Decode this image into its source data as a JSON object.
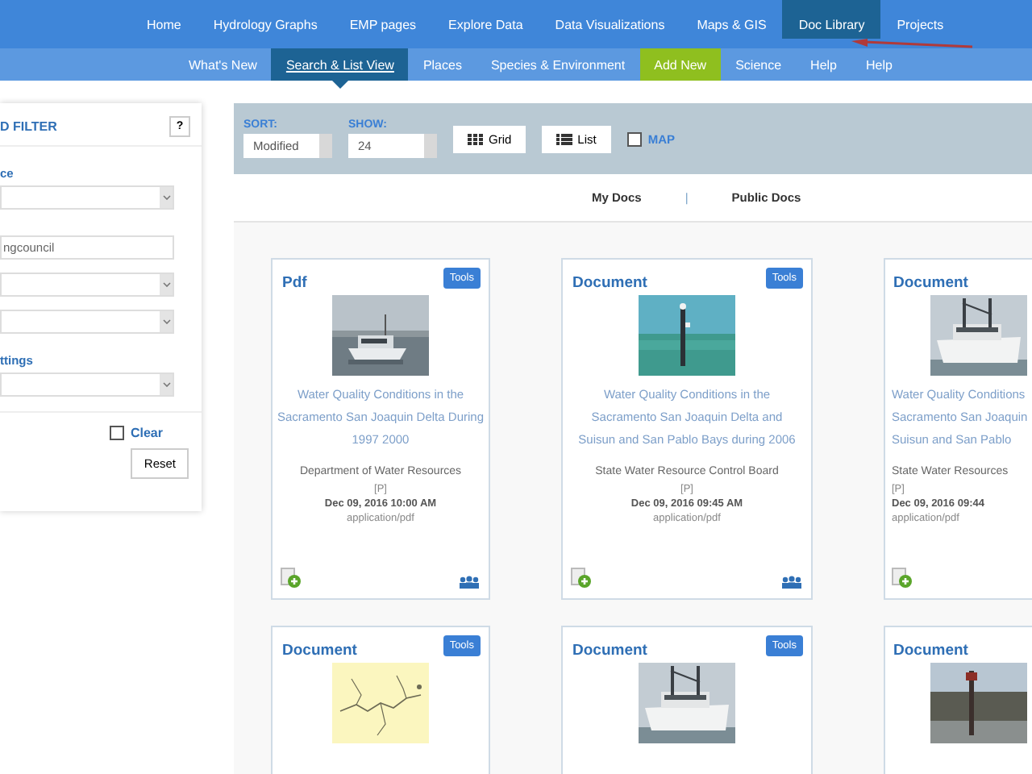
{
  "main_nav": [
    {
      "label": "Home",
      "selected": false
    },
    {
      "label": "Hydrology Graphs",
      "selected": false
    },
    {
      "label": "EMP pages",
      "selected": false
    },
    {
      "label": "Explore Data",
      "selected": false
    },
    {
      "label": "Data Visualizations",
      "selected": false
    },
    {
      "label": "Maps & GIS",
      "selected": false
    },
    {
      "label": "Doc Library",
      "selected": true
    },
    {
      "label": "Projects",
      "selected": false
    }
  ],
  "sub_nav": [
    {
      "label": "What's New",
      "selected": false,
      "kind": "link"
    },
    {
      "label": "Search & List View",
      "selected": true,
      "kind": "link"
    },
    {
      "label": "Places",
      "selected": false,
      "kind": "link"
    },
    {
      "label": "Species & Environment",
      "selected": false,
      "kind": "link"
    },
    {
      "label": "Add New",
      "selected": false,
      "kind": "accent"
    },
    {
      "label": "Science",
      "selected": false,
      "kind": "link"
    },
    {
      "label": "Help",
      "selected": false,
      "kind": "link"
    },
    {
      "label": "Help",
      "selected": false,
      "kind": "link"
    }
  ],
  "filter_panel": {
    "title": "D FILTER",
    "help": "?",
    "fields": [
      {
        "kind": "label",
        "text": "ce"
      },
      {
        "kind": "select"
      },
      {
        "kind": "input",
        "value": "ngcouncil"
      },
      {
        "kind": "select"
      },
      {
        "kind": "select"
      },
      {
        "kind": "label",
        "text": "ttings"
      },
      {
        "kind": "select"
      }
    ],
    "clear": {
      "label": "Clear",
      "checked": false
    },
    "reset": "Reset"
  },
  "toolbar": {
    "sort_label": "SORT:",
    "sort_value": "Modified",
    "show_label": "SHOW:",
    "show_value": "24",
    "grid": "Grid",
    "list": "List",
    "map": {
      "label": "MAP",
      "checked": false
    }
  },
  "doc_tabs": {
    "items": [
      "My Docs",
      "Public Docs"
    ],
    "separator": "|"
  },
  "cards": [
    {
      "type": "Pdf",
      "tools": "Tools",
      "title_lines": [
        "Water Quality Conditions in the",
        "Sacramento San Joaquin Delta During",
        "1997 2000"
      ],
      "publisher": "Department of Water Resources",
      "tag": "[P]",
      "date": "Dec 09, 2016 10:00 AM",
      "mime": "application/pdf",
      "shared": true
    },
    {
      "type": "Document",
      "tools": "Tools",
      "title_lines": [
        "Water Quality Conditions in the",
        "Sacramento San Joaquin Delta and",
        "Suisun and San Pablo Bays during 2006"
      ],
      "publisher": "State Water Resource Control Board",
      "tag": "[P]",
      "date": "Dec 09, 2016 09:45 AM",
      "mime": "application/pdf",
      "shared": true
    },
    {
      "type": "Document",
      "title_lines": [
        "Water Quality Conditions",
        "Sacramento San Joaquin",
        "Suisun and San Pablo"
      ],
      "publisher": "State Water Resources",
      "tag": "[P]",
      "date": "Dec 09, 2016 09:44",
      "mime": "application/pdf"
    },
    {
      "type": "Document",
      "tools": "Tools"
    },
    {
      "type": "Document",
      "tools": "Tools"
    },
    {
      "type": "Document"
    }
  ]
}
